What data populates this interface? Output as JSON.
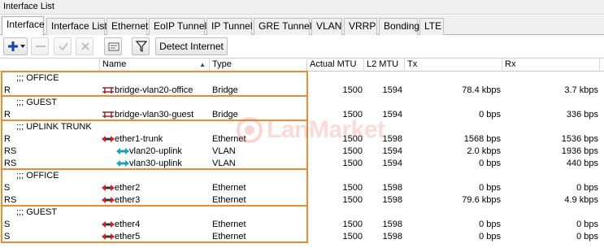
{
  "window": {
    "title": "Interface List"
  },
  "tabs": [
    {
      "label": "Interface",
      "active": true
    },
    {
      "label": "Interface List"
    },
    {
      "label": "Ethernet"
    },
    {
      "label": "EoIP Tunnel"
    },
    {
      "label": "IP Tunnel"
    },
    {
      "label": "GRE Tunnel"
    },
    {
      "label": "VLAN"
    },
    {
      "label": "VRRP"
    },
    {
      "label": "Bonding"
    },
    {
      "label": "LTE"
    }
  ],
  "toolbar": {
    "add_icon": "plus-dropdown-icon",
    "remove_icon": "minus-icon",
    "enable_icon": "check-icon",
    "disable_icon": "x-icon",
    "comment_icon": "note-icon",
    "filter_icon": "filter-icon",
    "detect_internet_label": "Detect Internet"
  },
  "columns": {
    "flags": "",
    "name": "Name",
    "type": "Type",
    "actual_mtu": "Actual MTU",
    "l2_mtu": "L2 MTU",
    "tx": "Tx",
    "rx": "Rx"
  },
  "rows": [
    {
      "kind": "comment",
      "text": ";;; OFFICE"
    },
    {
      "kind": "iface",
      "flags": "R",
      "icon": "bridge-icon",
      "name": "bridge-vlan20-office",
      "type": "Bridge",
      "actual_mtu": "1500",
      "l2_mtu": "1594",
      "tx": "78.4 kbps",
      "rx": "3.7 kbps"
    },
    {
      "kind": "comment",
      "text": ";;; GUEST"
    },
    {
      "kind": "iface",
      "flags": "R",
      "icon": "bridge-icon",
      "name": "bridge-vlan30-guest",
      "type": "Bridge",
      "actual_mtu": "1500",
      "l2_mtu": "1594",
      "tx": "0 bps",
      "rx": "336 bps"
    },
    {
      "kind": "comment",
      "text": ";;; UPLINK TRUNK"
    },
    {
      "kind": "iface",
      "flags": "R",
      "icon": "ethernet-icon",
      "name": "ether1-trunk",
      "type": "Ethernet",
      "actual_mtu": "1500",
      "l2_mtu": "1598",
      "tx": "1568 bps",
      "rx": "1536 bps"
    },
    {
      "kind": "iface",
      "flags": "RS",
      "icon": "vlan-icon",
      "indent": true,
      "name": "vlan20-uplink",
      "type": "VLAN",
      "actual_mtu": "1500",
      "l2_mtu": "1594",
      "tx": "2.0 kbps",
      "rx": "1936 bps"
    },
    {
      "kind": "iface",
      "flags": "RS",
      "icon": "vlan-icon",
      "indent": true,
      "name": "vlan30-uplink",
      "type": "VLAN",
      "actual_mtu": "1500",
      "l2_mtu": "1594",
      "tx": "0 bps",
      "rx": "440 bps"
    },
    {
      "kind": "comment",
      "text": ";;; OFFICE"
    },
    {
      "kind": "iface",
      "flags": "S",
      "icon": "ethernet-icon",
      "name": "ether2",
      "type": "Ethernet",
      "actual_mtu": "1500",
      "l2_mtu": "1598",
      "tx": "0 bps",
      "rx": "0 bps"
    },
    {
      "kind": "iface",
      "flags": "RS",
      "icon": "ethernet-icon",
      "name": "ether3",
      "type": "Ethernet",
      "actual_mtu": "1500",
      "l2_mtu": "1598",
      "tx": "79.6 kbps",
      "rx": "4.9 kbps"
    },
    {
      "kind": "comment",
      "text": ";;; GUEST"
    },
    {
      "kind": "iface",
      "flags": "S",
      "icon": "ethernet-icon",
      "name": "ether4",
      "type": "Ethernet",
      "actual_mtu": "1500",
      "l2_mtu": "1598",
      "tx": "0 bps",
      "rx": "0 bps"
    },
    {
      "kind": "iface",
      "flags": "S",
      "icon": "ethernet-icon",
      "name": "ether5",
      "type": "Ethernet",
      "actual_mtu": "1500",
      "l2_mtu": "1598",
      "tx": "0 bps",
      "rx": "0 bps"
    }
  ],
  "watermark": {
    "text": "LanMarket",
    "icon": "lanmarket-logo-icon"
  },
  "highlight_color": "#f08a32"
}
